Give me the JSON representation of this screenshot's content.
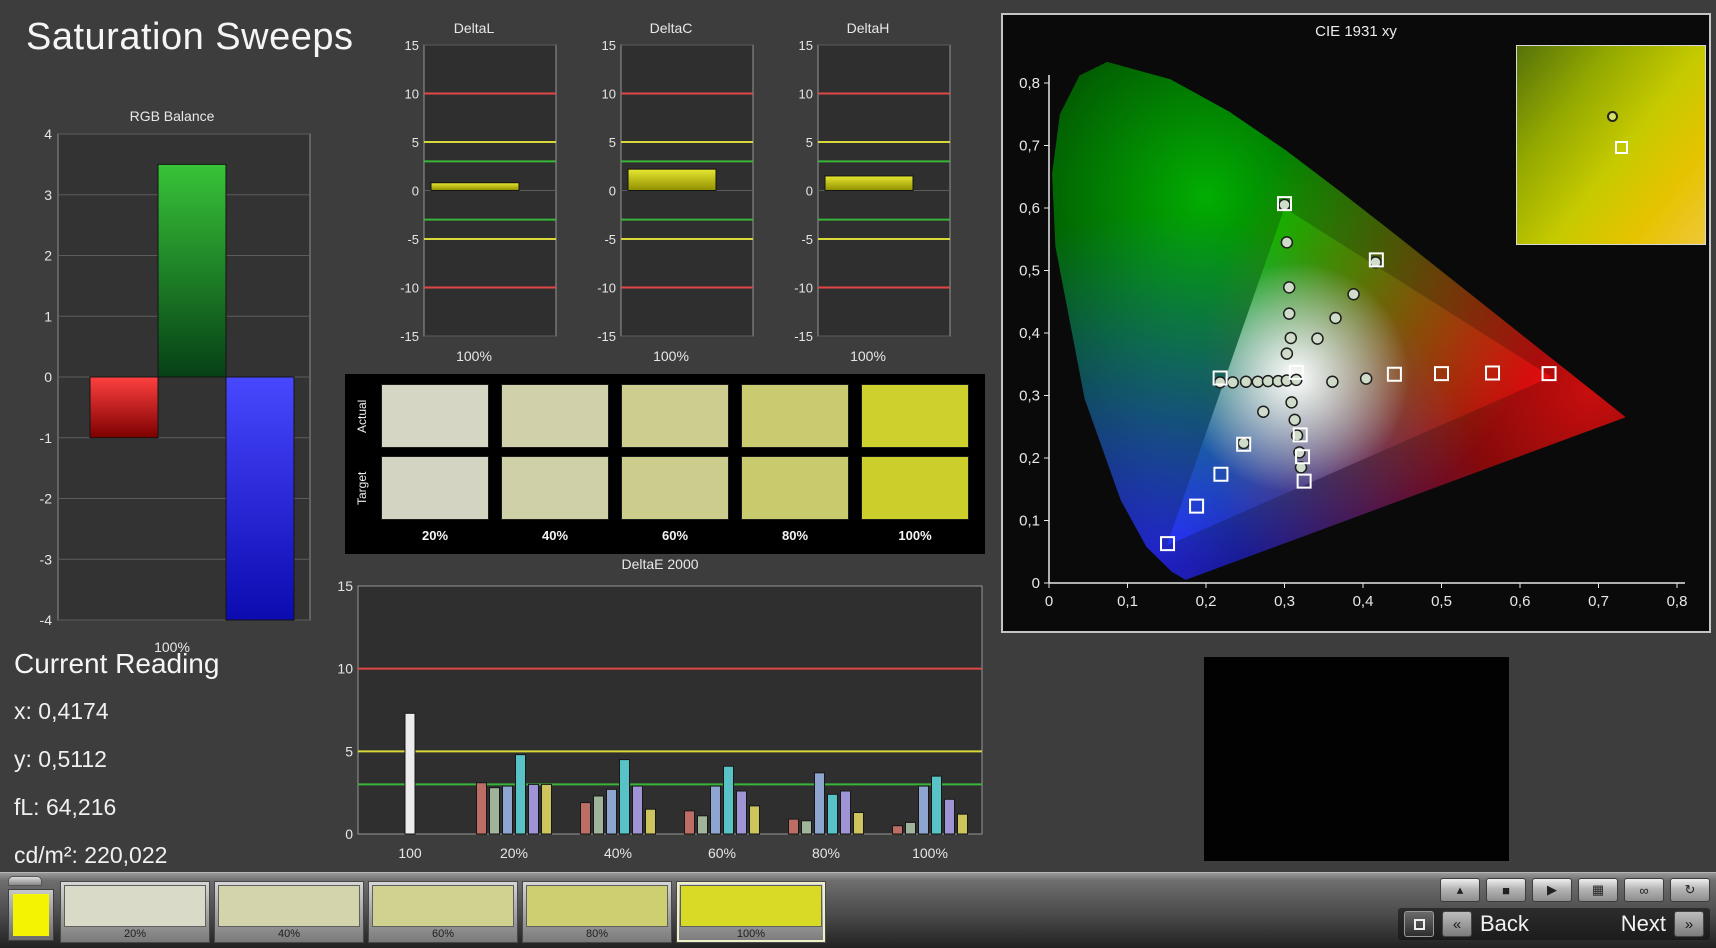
{
  "page": {
    "title": "Saturation Sweeps"
  },
  "current_reading": {
    "heading": "Current Reading",
    "x": "x: 0,4174",
    "y": "y: 0,5112",
    "fl": "fL: 64,216",
    "cdm2": "cd/m²: 220,022"
  },
  "swatch_table": {
    "row_labels": [
      "Actual",
      "Target"
    ],
    "columns": [
      "20%",
      "40%",
      "60%",
      "80%",
      "100%"
    ],
    "actual_colors": [
      "#d6d6c5",
      "#d0d0aa",
      "#cdcd8f",
      "#caca70",
      "#ced02e"
    ],
    "target_colors": [
      "#d4d4c3",
      "#cfcfa8",
      "#cccc8d",
      "#c9c96e",
      "#ccce2c"
    ]
  },
  "chart_data": [
    {
      "id": "rgb_balance",
      "type": "bar",
      "title": "RGB Balance",
      "categories": [
        "Red",
        "Green",
        "Blue"
      ],
      "values": [
        -1,
        3.5,
        -4
      ],
      "ylim": [
        -4,
        4
      ],
      "y_ticks": [
        4,
        3,
        2,
        1,
        0,
        -1,
        -2,
        -3,
        -4
      ],
      "xlabel": "100%",
      "grid": true,
      "bar_colors": [
        "#e02020",
        "#28a828",
        "#2828e8"
      ]
    },
    {
      "id": "deltaL",
      "type": "bar",
      "title": "DeltaL",
      "categories": [
        "100%"
      ],
      "values": [
        0.8
      ],
      "ylim": [
        -15,
        15
      ],
      "y_ticks": [
        15,
        10,
        5,
        0,
        -5,
        -10,
        -15
      ],
      "xlabel": "100%",
      "thresholds": {
        "green": 3,
        "yellow": 5,
        "red": 10
      },
      "bar_color": "#d8d820"
    },
    {
      "id": "deltaC",
      "type": "bar",
      "title": "DeltaC",
      "categories": [
        "100%"
      ],
      "values": [
        2.2
      ],
      "ylim": [
        -15,
        15
      ],
      "y_ticks": [
        15,
        10,
        5,
        0,
        -5,
        -10,
        -15
      ],
      "xlabel": "100%",
      "thresholds": {
        "green": 3,
        "yellow": 5,
        "red": 10
      },
      "bar_color": "#d8d820"
    },
    {
      "id": "deltaH",
      "type": "bar",
      "title": "DeltaH",
      "categories": [
        "100%"
      ],
      "values": [
        1.5
      ],
      "ylim": [
        -15,
        15
      ],
      "y_ticks": [
        15,
        10,
        5,
        0,
        -5,
        -10,
        -15
      ],
      "xlabel": "100%",
      "thresholds": {
        "green": 3,
        "yellow": 5,
        "red": 10
      },
      "bar_color": "#d8d820"
    },
    {
      "id": "deltae2000",
      "type": "bar",
      "title": "DeltaE 2000",
      "categories": [
        "100",
        "20%",
        "40%",
        "60%",
        "80%",
        "100%"
      ],
      "groups": [
        [
          7.3
        ],
        [
          3.1,
          2.8,
          2.9,
          4.8,
          3.0,
          3.0
        ],
        [
          1.9,
          2.3,
          2.7,
          4.5,
          2.9,
          1.5
        ],
        [
          1.4,
          1.1,
          2.9,
          4.1,
          2.6,
          1.7
        ],
        [
          0.9,
          0.8,
          3.7,
          2.4,
          2.6,
          1.3
        ],
        [
          0.5,
          0.7,
          2.9,
          3.5,
          2.1,
          1.2
        ]
      ],
      "first_group_color": "#ececec",
      "bar_colors": [
        "#bc6e66",
        "#9fb49b",
        "#8ea6cf",
        "#58c3c6",
        "#9e94d6",
        "#cdc45e"
      ],
      "ylim": [
        0,
        15
      ],
      "y_ticks": [
        0,
        5,
        10,
        15
      ],
      "thresholds": {
        "green": 3,
        "yellow": 5,
        "red": 10
      }
    },
    {
      "id": "cie1931",
      "type": "scatter",
      "title": "CIE 1931 xy",
      "xlim": [
        0,
        0.8
      ],
      "ylim": [
        0,
        0.8
      ],
      "x_ticks": [
        "0",
        "0,1",
        "0,2",
        "0,3",
        "0,4",
        "0,5",
        "0,6",
        "0,7",
        "0,8"
      ],
      "y_ticks": [
        "0",
        "0,1",
        "0,2",
        "0,3",
        "0,4",
        "0,5",
        "0,6",
        "0,7",
        "0,8"
      ],
      "gamut_triangle": [
        [
          0.64,
          0.33
        ],
        [
          0.3,
          0.6
        ],
        [
          0.15,
          0.06
        ]
      ],
      "targets_squares": [
        [
          0.315,
          0.337
        ],
        [
          0.44,
          0.334
        ],
        [
          0.5,
          0.335
        ],
        [
          0.565,
          0.336
        ],
        [
          0.637,
          0.335
        ],
        [
          0.3,
          0.607
        ],
        [
          0.417,
          0.517
        ],
        [
          0.32,
          0.237
        ],
        [
          0.323,
          0.202
        ],
        [
          0.325,
          0.163
        ],
        [
          0.248,
          0.222
        ],
        [
          0.219,
          0.174
        ],
        [
          0.188,
          0.123
        ],
        [
          0.151,
          0.063
        ],
        [
          0.218,
          0.328
        ]
      ],
      "measured_circles": [
        [
          0.3,
          0.605
        ],
        [
          0.303,
          0.545
        ],
        [
          0.306,
          0.473
        ],
        [
          0.306,
          0.431
        ],
        [
          0.308,
          0.392
        ],
        [
          0.303,
          0.367
        ],
        [
          0.218,
          0.321
        ],
        [
          0.234,
          0.321
        ],
        [
          0.251,
          0.322
        ],
        [
          0.266,
          0.322
        ],
        [
          0.279,
          0.323
        ],
        [
          0.292,
          0.323
        ],
        [
          0.303,
          0.324
        ],
        [
          0.315,
          0.325
        ],
        [
          0.342,
          0.391
        ],
        [
          0.365,
          0.424
        ],
        [
          0.388,
          0.462
        ],
        [
          0.416,
          0.513
        ],
        [
          0.361,
          0.322
        ],
        [
          0.404,
          0.327
        ],
        [
          0.309,
          0.289
        ],
        [
          0.313,
          0.261
        ],
        [
          0.316,
          0.236
        ],
        [
          0.319,
          0.209
        ],
        [
          0.321,
          0.185
        ],
        [
          0.273,
          0.274
        ],
        [
          0.248,
          0.224
        ]
      ]
    }
  ],
  "taskbar": {
    "patch_preview_color": "#f4f400",
    "swatches": [
      {
        "label": "20%",
        "color": "#dadac9",
        "selected": false
      },
      {
        "label": "40%",
        "color": "#d4d4ac",
        "selected": false
      },
      {
        "label": "60%",
        "color": "#d1d190",
        "selected": false
      },
      {
        "label": "80%",
        "color": "#cecf70",
        "selected": false
      },
      {
        "label": "100%",
        "color": "#d8da26",
        "selected": true
      }
    ],
    "controls": [
      {
        "name": "collapse-button",
        "glyph": "▴"
      },
      {
        "name": "stop-button",
        "glyph": "■"
      },
      {
        "name": "play-button",
        "glyph": "▶"
      },
      {
        "name": "save-button",
        "glyph": "▦"
      },
      {
        "name": "loop-button",
        "glyph": "∞"
      },
      {
        "name": "refresh-button",
        "glyph": "↻"
      }
    ],
    "back_label": "Back",
    "next_label": "Next",
    "prev_glyph": "«",
    "next_glyph": "»"
  }
}
